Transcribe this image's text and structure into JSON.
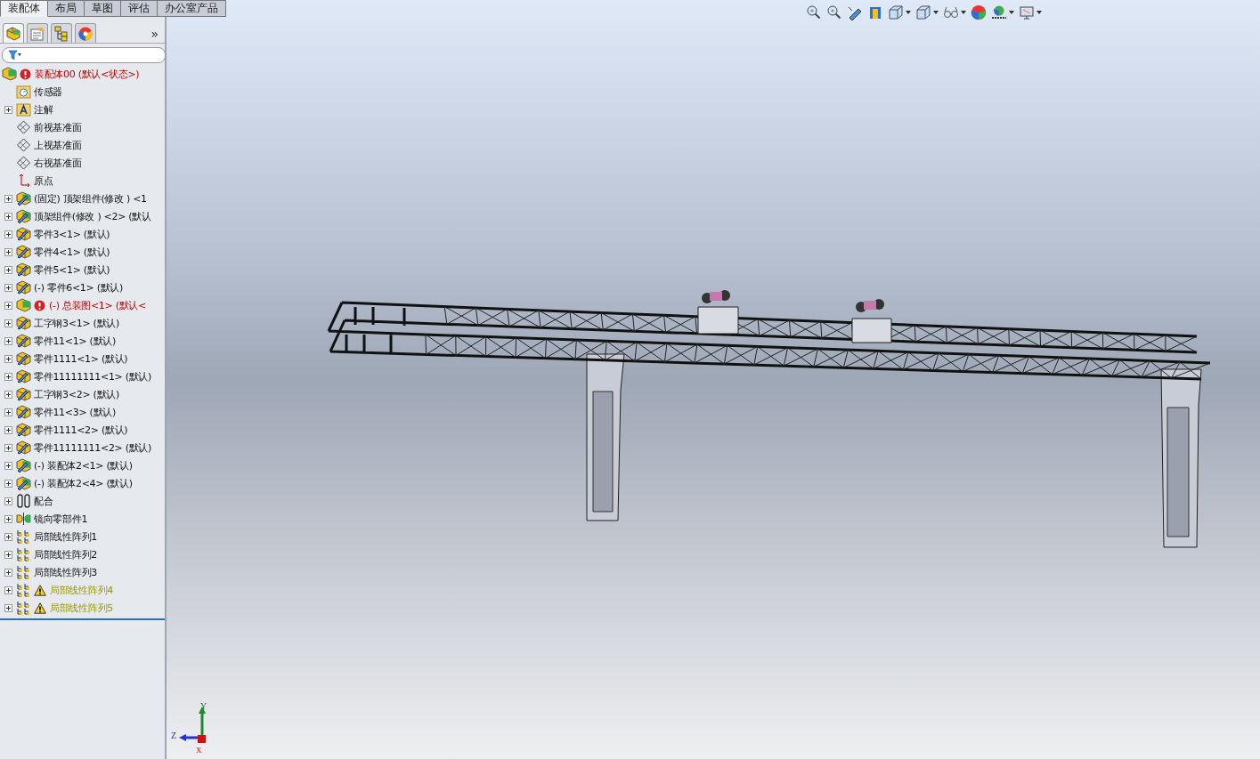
{
  "command_tabs": [
    {
      "label": "装配体",
      "selected": true
    },
    {
      "label": "布局",
      "selected": false
    },
    {
      "label": "草图",
      "selected": false
    },
    {
      "label": "评估",
      "selected": false
    },
    {
      "label": "办公室产品",
      "selected": false
    }
  ],
  "panel_tabs": [
    {
      "kind": "tree",
      "selected": true
    },
    {
      "kind": "property",
      "selected": false
    },
    {
      "kind": "config",
      "selected": false
    },
    {
      "kind": "appearance",
      "selected": false
    }
  ],
  "panel_more": "»",
  "tree": [
    {
      "kind": "root",
      "label": "装配体00  (默认<状态>)",
      "error": true,
      "warning": false,
      "expandable": false
    },
    {
      "kind": "sensor",
      "label": "传感器",
      "error": false,
      "warning": false,
      "expandable": false
    },
    {
      "kind": "annotation",
      "label": "注解",
      "error": false,
      "warning": false,
      "expandable": true
    },
    {
      "kind": "plane",
      "label": "前视基准面",
      "error": false,
      "warning": false,
      "expandable": false
    },
    {
      "kind": "plane",
      "label": "上视基准面",
      "error": false,
      "warning": false,
      "expandable": false
    },
    {
      "kind": "plane",
      "label": "右视基准面",
      "error": false,
      "warning": false,
      "expandable": false
    },
    {
      "kind": "origin",
      "label": "原点",
      "error": false,
      "warning": false,
      "expandable": false
    },
    {
      "kind": "subassembly",
      "label": "(固定) 顶架组件(修改 ) <1",
      "error": false,
      "warning": false,
      "expandable": true
    },
    {
      "kind": "subassembly",
      "label": "顶架组件(修改 ) <2> (默认",
      "error": false,
      "warning": false,
      "expandable": true
    },
    {
      "kind": "part",
      "label": "零件3<1> (默认)",
      "error": false,
      "warning": false,
      "expandable": true
    },
    {
      "kind": "part",
      "label": "零件4<1> (默认)",
      "error": false,
      "warning": false,
      "expandable": true
    },
    {
      "kind": "part",
      "label": "零件5<1> (默认)",
      "error": false,
      "warning": false,
      "expandable": true
    },
    {
      "kind": "part",
      "label": "(-) 零件6<1> (默认)",
      "error": false,
      "warning": false,
      "expandable": true
    },
    {
      "kind": "root",
      "label": "(-) 总装图<1> (默认<",
      "error": true,
      "warning": false,
      "expandable": true
    },
    {
      "kind": "part",
      "label": "工字钢3<1> (默认)",
      "error": false,
      "warning": false,
      "expandable": true
    },
    {
      "kind": "part",
      "label": "零件11<1> (默认)",
      "error": false,
      "warning": false,
      "expandable": true
    },
    {
      "kind": "part",
      "label": "零件1111<1> (默认)",
      "error": false,
      "warning": false,
      "expandable": true
    },
    {
      "kind": "part",
      "label": "零件11111111<1> (默认)",
      "error": false,
      "warning": false,
      "expandable": true
    },
    {
      "kind": "part",
      "label": "工字钢3<2> (默认)",
      "error": false,
      "warning": false,
      "expandable": true
    },
    {
      "kind": "part",
      "label": "零件11<3> (默认)",
      "error": false,
      "warning": false,
      "expandable": true
    },
    {
      "kind": "part",
      "label": "零件1111<2> (默认)",
      "error": false,
      "warning": false,
      "expandable": true
    },
    {
      "kind": "part",
      "label": "零件11111111<2> (默认)",
      "error": false,
      "warning": false,
      "expandable": true
    },
    {
      "kind": "subassembly",
      "label": "(-) 装配体2<1> (默认)",
      "error": false,
      "warning": false,
      "expandable": true
    },
    {
      "kind": "subassembly",
      "label": "(-) 装配体2<4> (默认)",
      "error": false,
      "warning": false,
      "expandable": true
    },
    {
      "kind": "mate",
      "label": "配合",
      "error": false,
      "warning": false,
      "expandable": true
    },
    {
      "kind": "mirror",
      "label": "镜向零部件1",
      "error": false,
      "warning": false,
      "expandable": true
    },
    {
      "kind": "pattern",
      "label": "局部线性阵列1",
      "error": false,
      "warning": false,
      "expandable": true
    },
    {
      "kind": "pattern",
      "label": "局部线性阵列2",
      "error": false,
      "warning": false,
      "expandable": true
    },
    {
      "kind": "pattern",
      "label": "局部线性阵列3",
      "error": false,
      "warning": false,
      "expandable": true
    },
    {
      "kind": "pattern",
      "label": "局部线性阵列4",
      "error": false,
      "warning": true,
      "expandable": true
    },
    {
      "kind": "pattern",
      "label": "局部线性阵列5",
      "error": false,
      "warning": true,
      "expandable": true
    }
  ],
  "triad": {
    "y": "Y",
    "z": "Z",
    "x": "X"
  }
}
